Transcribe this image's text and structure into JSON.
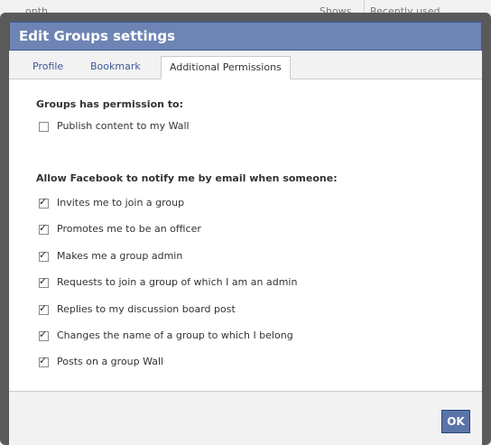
{
  "background_table": {
    "col1": "onth",
    "col2": "Shows",
    "col3": "Recently used"
  },
  "dialog": {
    "title": "Edit Groups settings",
    "tabs": [
      {
        "label": "Profile",
        "active": false
      },
      {
        "label": "Bookmark",
        "active": false
      },
      {
        "label": "Additional Permissions",
        "active": true
      }
    ],
    "permission_section": {
      "title": "Groups has permission to:",
      "options": [
        {
          "label": "Publish content to my Wall",
          "checked": false
        }
      ]
    },
    "email_section": {
      "title": "Allow Facebook to notify me by email when someone:",
      "options": [
        {
          "label": "Invites me to join a group",
          "checked": true
        },
        {
          "label": "Promotes me to be an officer",
          "checked": true
        },
        {
          "label": "Makes me a group admin",
          "checked": true
        },
        {
          "label": "Requests to join a group of which I am an admin",
          "checked": true
        },
        {
          "label": "Replies to my discussion board post",
          "checked": true
        },
        {
          "label": "Changes the name of a group to which I belong",
          "checked": true
        },
        {
          "label": "Posts on a group Wall",
          "checked": true
        }
      ]
    },
    "ok_label": "OK"
  },
  "colors": {
    "title_bar": "#6d84b4",
    "link": "#3b5998",
    "ok_button": "#5b74a8"
  }
}
